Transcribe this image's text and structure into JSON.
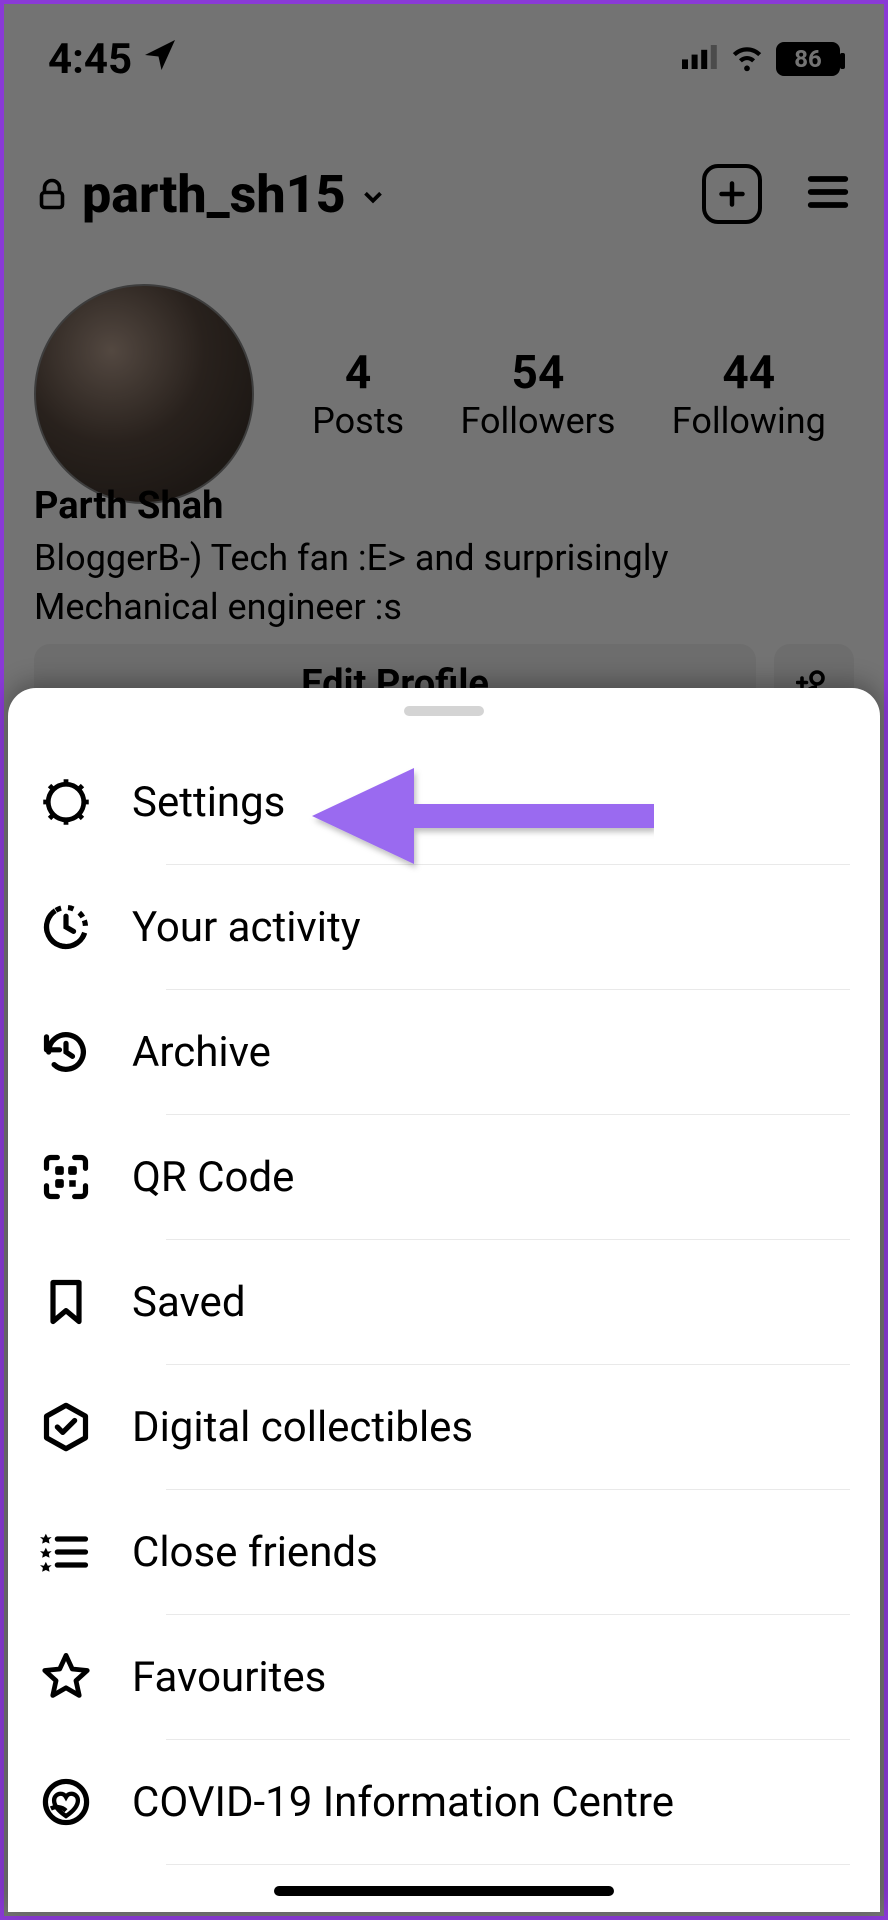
{
  "status": {
    "time": "4:45",
    "battery": "86"
  },
  "header": {
    "username": "parth_sh15"
  },
  "stats": {
    "posts_count": "4",
    "posts_label": "Posts",
    "followers_count": "54",
    "followers_label": "Followers",
    "following_count": "44",
    "following_label": "Following"
  },
  "bio": {
    "display_name": "Parth Shah",
    "text": "BloggerB-) Tech fan :E> and surprisingly Mechanical engineer :s"
  },
  "actions": {
    "edit_profile": "Edit Profile"
  },
  "menu": {
    "items": [
      {
        "icon": "settings-gear-icon",
        "label": "Settings"
      },
      {
        "icon": "activity-clock-icon",
        "label": "Your activity"
      },
      {
        "icon": "archive-history-icon",
        "label": "Archive"
      },
      {
        "icon": "qr-code-icon",
        "label": "QR Code"
      },
      {
        "icon": "saved-bookmark-icon",
        "label": "Saved"
      },
      {
        "icon": "digital-collectibles-icon",
        "label": "Digital collectibles"
      },
      {
        "icon": "close-friends-icon",
        "label": "Close friends"
      },
      {
        "icon": "favourites-star-icon",
        "label": "Favourites"
      },
      {
        "icon": "covid-info-icon",
        "label": "COVID-19 Information Centre"
      }
    ]
  },
  "annotation": {
    "target": "Settings",
    "color": "#9a6bf0"
  }
}
